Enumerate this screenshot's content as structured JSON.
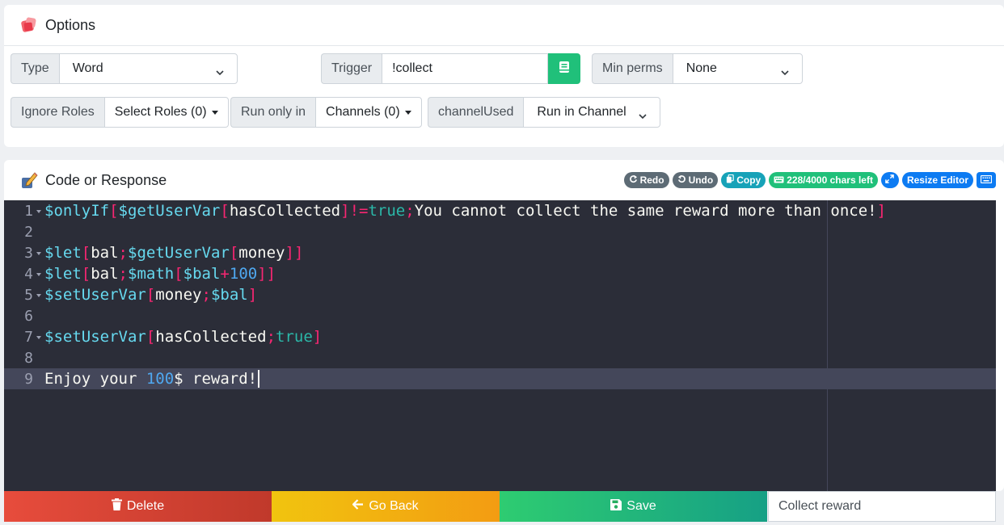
{
  "options": {
    "title": "Options",
    "type_label": "Type",
    "type_value": "Word",
    "trigger_label": "Trigger",
    "trigger_value": "!collect",
    "minperms_label": "Min perms",
    "minperms_value": "None",
    "ignore_roles_label": "Ignore Roles",
    "select_roles_value": "Select Roles (0)",
    "run_only_in_label": "Run only in",
    "channels_value": "Channels (0)",
    "channel_used_label": "channelUsed",
    "channel_used_value": "Run in Channel"
  },
  "code": {
    "title": "Code or Response",
    "redo_label": "Redo",
    "undo_label": "Undo",
    "copy_label": "Copy",
    "chars_left_label": "228/4000 chars left",
    "resize_label": "Resize Editor",
    "lines": [
      {
        "num": "1",
        "text": "$onlyIf[$getUserVar[hasCollected]!=true;You cannot collect the same reward more than once!]"
      },
      {
        "num": "2",
        "text": ""
      },
      {
        "num": "3",
        "text": "$let[bal;$getUserVar[money]]"
      },
      {
        "num": "4",
        "text": "$let[bal;$math[$bal+100]]"
      },
      {
        "num": "5",
        "text": "$setUserVar[money;$bal]"
      },
      {
        "num": "6",
        "text": ""
      },
      {
        "num": "7",
        "text": "$setUserVar[hasCollected;true]"
      },
      {
        "num": "8",
        "text": ""
      },
      {
        "num": "9",
        "text": "Enjoy your 100$ reward!"
      }
    ]
  },
  "footer": {
    "delete_label": "Delete",
    "back_label": "Go Back",
    "save_label": "Save",
    "name_value": "Collect reward"
  },
  "colors": {
    "delete": "#e74c3c",
    "back": "#f1c40f",
    "save": "#2ecc71",
    "editor_bg": "#2b2d38"
  }
}
